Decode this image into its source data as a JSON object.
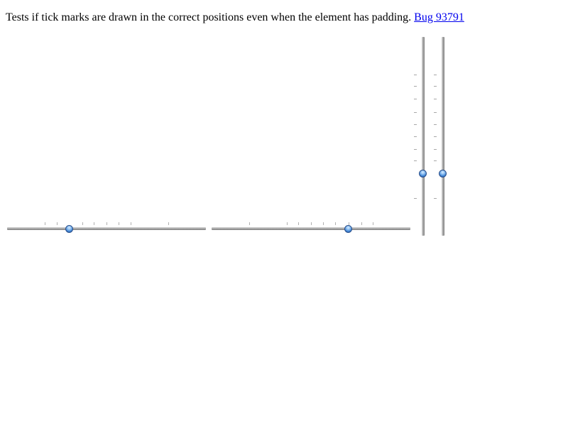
{
  "description": {
    "text": "Tests if tick marks are drawn in the correct positions even when the element has padding.",
    "link_text": "Bug 93791"
  },
  "sliders": [
    {
      "orientation": "horizontal",
      "value": 0.3,
      "ticks": [
        0.17,
        0.235,
        0.37,
        0.43,
        0.5,
        0.565,
        0.63,
        0.83
      ]
    },
    {
      "orientation": "horizontal",
      "value": 0.7,
      "ticks": [
        0.17,
        0.37,
        0.43,
        0.5,
        0.565,
        0.63,
        0.7,
        0.77,
        0.83
      ]
    },
    {
      "orientation": "vertical",
      "value": 0.3,
      "ticks": [
        0.17,
        0.37,
        0.43,
        0.5,
        0.565,
        0.63,
        0.7,
        0.77,
        0.83
      ]
    },
    {
      "orientation": "vertical",
      "value": 0.3,
      "ticks": [
        0.17,
        0.37,
        0.43,
        0.5,
        0.565,
        0.63,
        0.7,
        0.77,
        0.83
      ]
    }
  ],
  "colors": {
    "link": "#0000ee",
    "thumb": "#3a7fd0",
    "track": "#a7a7a7"
  },
  "icons": {
    "thumb": "blue-sphere-thumb-icon"
  }
}
